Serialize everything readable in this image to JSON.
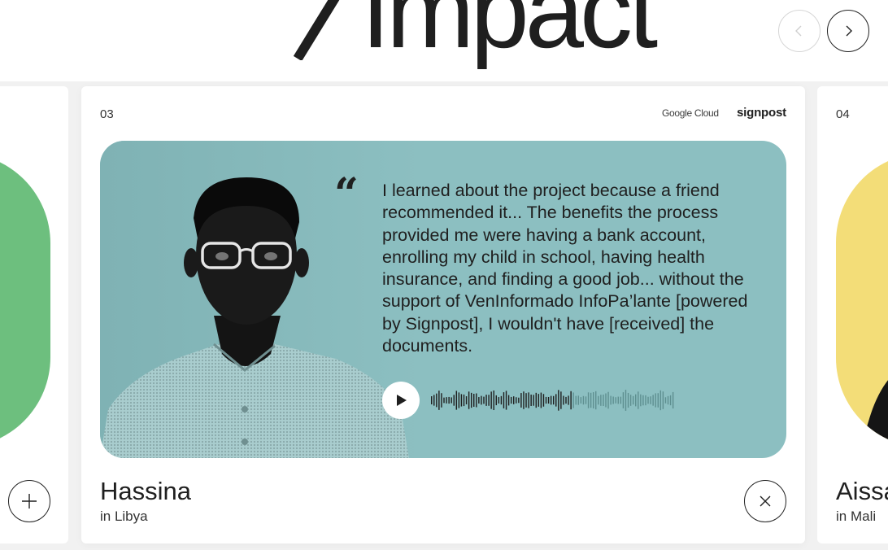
{
  "header": {
    "title": "Impact"
  },
  "nav": {
    "prev_icon": "chevron-left-icon",
    "next_icon": "chevron-right-icon"
  },
  "cards": {
    "previous": {
      "action_icon": "plus-icon",
      "accent_color": "#6dbf7e"
    },
    "current": {
      "index": "03",
      "partners": [
        "Google Cloud",
        "signpost"
      ],
      "quote": "I learned about the project because a friend recommended it... The benefits the process provided me were having a bank account, enrolling my child in school, having health insurance, and finding a good job... without the support of VenInformado InfoPa’lante [powered by Signpost], I wouldn't have [received] the documents.",
      "name": "Hassina",
      "location": "in Libya",
      "panel_color": "#8cbfc1",
      "audio": {
        "play_icon": "play-icon",
        "progress": 0.58
      },
      "close_icon": "close-icon"
    },
    "next": {
      "index": "04",
      "name": "Aissa",
      "location": "in Mali",
      "accent_color": "#f3dd78"
    }
  }
}
